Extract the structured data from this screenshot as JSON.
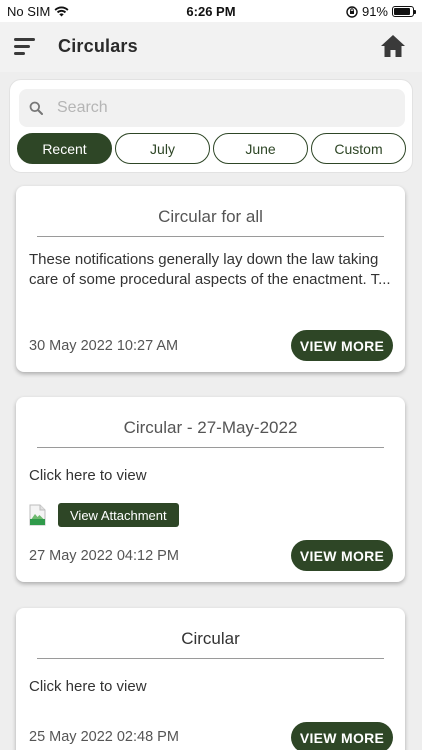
{
  "status_bar": {
    "carrier": "No SIM",
    "time": "6:26 PM",
    "battery": "91%",
    "battery_level": 0.91
  },
  "header": {
    "title": "Circulars",
    "menu_icon": "hamburger-menu-icon",
    "home_icon": "home-icon"
  },
  "search": {
    "placeholder": "Search",
    "value": ""
  },
  "filters": [
    {
      "label": "Recent",
      "active": true
    },
    {
      "label": "July",
      "active": false
    },
    {
      "label": "June",
      "active": false
    },
    {
      "label": "Custom",
      "active": false
    }
  ],
  "circulars": [
    {
      "title": "Circular for all",
      "body": "These notifications generally lay down the law taking care of some procedural aspects of the enactment. T...",
      "date": "30 May 2022 10:27 AM",
      "action": "VIEW MORE"
    },
    {
      "title": "Circular - 27-May-2022",
      "body": "Click here to view",
      "attachment_label": "View Attachment",
      "date": "27 May 2022 04:12 PM",
      "action": "VIEW MORE"
    },
    {
      "title": "Circular",
      "body": "Click here to view",
      "date": "25 May 2022 02:48 PM",
      "action": "VIEW MORE"
    }
  ],
  "colors": {
    "primary": "#2e4626",
    "background": "#eeeeee",
    "card": "#ffffff"
  }
}
